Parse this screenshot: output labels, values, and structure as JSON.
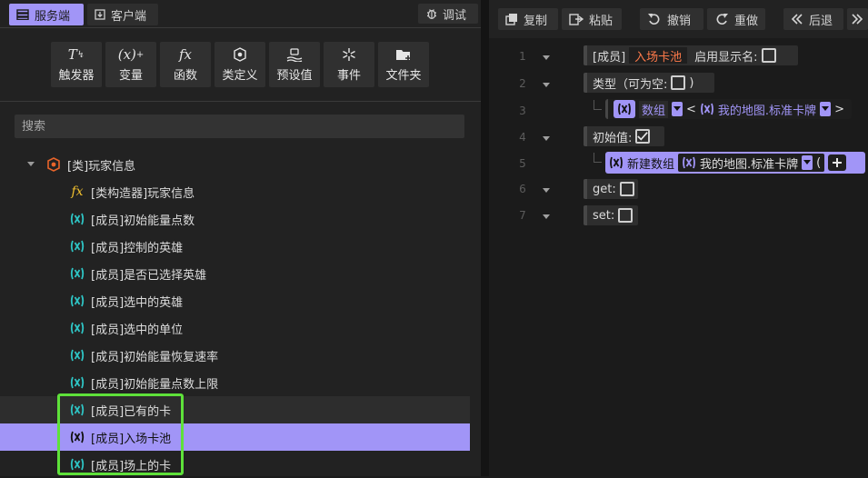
{
  "tabs": {
    "server": "服务端",
    "client": "客户端",
    "debug": "调试"
  },
  "tools": [
    {
      "label": "触发器",
      "icon": "trigger-icon"
    },
    {
      "label": "变量",
      "icon": "variable-icon"
    },
    {
      "label": "函数",
      "icon": "function-icon"
    },
    {
      "label": "类定义",
      "icon": "class-definition-icon"
    },
    {
      "label": "预设值",
      "icon": "preset-icon"
    },
    {
      "label": "事件",
      "icon": "event-icon"
    },
    {
      "label": "文件夹",
      "icon": "folder-icon"
    }
  ],
  "search": {
    "placeholder": "搜索"
  },
  "tree": {
    "class_label": "[类]玩家信息",
    "items": [
      {
        "label": "[类构造器]玩家信息",
        "icon": "function-icon"
      },
      {
        "label": "[成员]初始能量点数",
        "icon": "variable-icon"
      },
      {
        "label": "[成员]控制的英雄",
        "icon": "variable-icon"
      },
      {
        "label": "[成员]是否已选择英雄",
        "icon": "variable-icon"
      },
      {
        "label": "[成员]选中的英雄",
        "icon": "variable-icon"
      },
      {
        "label": "[成员]选中的单位",
        "icon": "variable-icon"
      },
      {
        "label": "[成员]初始能量恢复速率",
        "icon": "variable-icon"
      },
      {
        "label": "[成员]初始能量点数上限",
        "icon": "variable-icon"
      },
      {
        "label": "[成员]已有的卡",
        "icon": "variable-icon"
      },
      {
        "label": "[成员]入场卡池",
        "icon": "variable-icon",
        "selected": true
      },
      {
        "label": "[成员]场上的卡",
        "icon": "variable-icon"
      }
    ]
  },
  "editor": {
    "toolbar": {
      "copy": "复制",
      "paste": "粘贴",
      "undo": "撤销",
      "redo": "重做",
      "back": "后退"
    },
    "line_numbers": [
      "1",
      "2",
      "3",
      "4",
      "5",
      "6",
      "7"
    ],
    "member_prefix": "[成员]",
    "member_name": "入场卡池",
    "show_name_label": "启用显示名:",
    "show_name_checked": false,
    "type_label": "类型（可为空:",
    "type_close": ")",
    "nullable_checked": false,
    "array_label": "数组",
    "lt": "<",
    "gt": ">",
    "element_type": "我的地图.标准卡牌",
    "init_label": "初始值:",
    "init_checked": true,
    "new_array_label": "新建数组",
    "new_array_paren": "(",
    "get_label": "get:",
    "get_checked": false,
    "set_label": "set:",
    "set_checked": false
  },
  "colors": {
    "accent": "#a195f7",
    "highlight": "#5ee13a",
    "name_text": "#ff7a4a",
    "variable_icon": "#2ec4c4",
    "function_icon": "#f2c12e",
    "class_icon": "#e8642a"
  }
}
